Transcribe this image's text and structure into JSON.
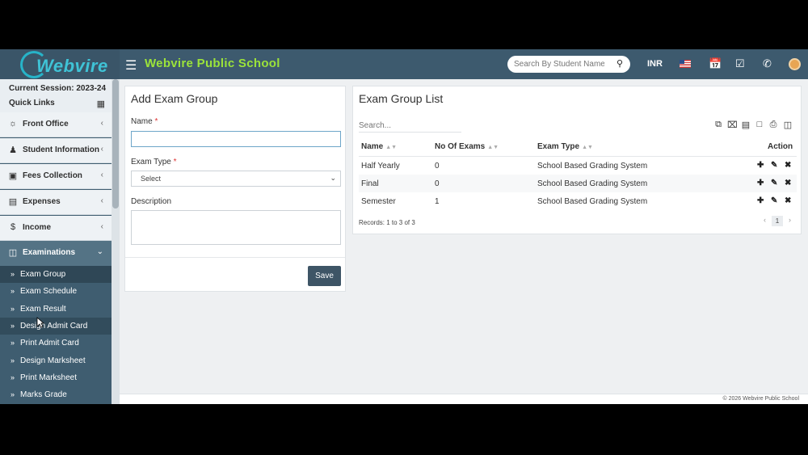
{
  "brand": {
    "logo_text": "Webvire",
    "school_name": "Webvire Public School"
  },
  "topbar": {
    "search_placeholder": "Search By Student Name",
    "currency": "INR"
  },
  "sidebar": {
    "session_label": "Current Session: 2023-24",
    "quick_links_label": "Quick Links",
    "menu": [
      {
        "label": "Front Office",
        "icon": "headset-icon"
      },
      {
        "label": "Student Information",
        "icon": "user-plus-icon"
      },
      {
        "label": "Fees Collection",
        "icon": "money-icon"
      },
      {
        "label": "Expenses",
        "icon": "credit-card-icon"
      },
      {
        "label": "Income",
        "icon": "dollar-icon"
      },
      {
        "label": "Examinations",
        "icon": "map-icon"
      }
    ],
    "examinations_sub": [
      {
        "label": "Exam Group"
      },
      {
        "label": "Exam Schedule"
      },
      {
        "label": "Exam Result"
      },
      {
        "label": "Design Admit Card"
      },
      {
        "label": "Print Admit Card"
      },
      {
        "label": "Design Marksheet"
      },
      {
        "label": "Print Marksheet"
      },
      {
        "label": "Marks Grade"
      }
    ]
  },
  "add_form": {
    "title": "Add Exam Group",
    "name_label": "Name",
    "name_value": "",
    "exam_type_label": "Exam Type",
    "exam_type_value": "Select",
    "description_label": "Description",
    "description_value": "",
    "save_label": "Save",
    "required_mark": "*"
  },
  "list": {
    "title": "Exam Group List",
    "search_placeholder": "Search...",
    "columns": {
      "name": "Name",
      "exams": "No Of Exams",
      "type": "Exam Type",
      "action": "Action"
    },
    "rows": [
      {
        "name": "Half Yearly",
        "exams": "0",
        "type": "School Based Grading System"
      },
      {
        "name": "Final",
        "exams": "0",
        "type": "School Based Grading System"
      },
      {
        "name": "Semester",
        "exams": "1",
        "type": "School Based Grading System"
      }
    ],
    "records_text": "Records: 1 to 3 of 3",
    "current_page": "1"
  },
  "footer": {
    "text": "© 2026 Webvire Public School"
  },
  "colors": {
    "topbar": "#3d5a6e",
    "accent_green": "#9be33a",
    "sidebar": "#3f5d70",
    "save_button": "#3e5566"
  }
}
